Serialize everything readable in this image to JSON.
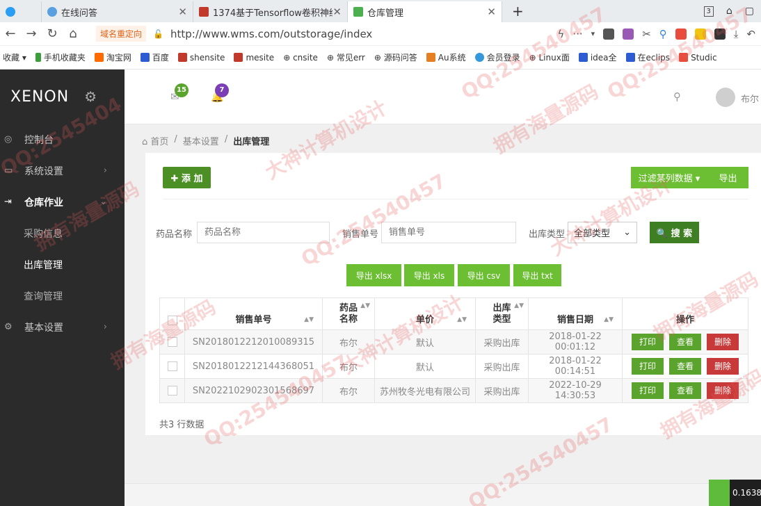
{
  "browser": {
    "tabs": [
      {
        "label": "在线问答",
        "color": "#3b82f6"
      },
      {
        "label": "1374基于Tensorflow卷积神经",
        "color": "#c0392b"
      },
      {
        "label": "仓库管理",
        "color": "#4caf50"
      }
    ],
    "redirect_label": "域名重定向",
    "url": "http://www.wms.com/outstorage/index",
    "tab_count_badge": "3",
    "bookmarks": [
      "收藏",
      "手机收藏夹",
      "淘宝网",
      "百度",
      "shensite",
      "mesite",
      "cnsite",
      "常见err",
      "源码问答",
      "Au系统",
      "会员登录",
      "Linux面",
      "idea全",
      "在eclips",
      "Studic"
    ]
  },
  "sidebar": {
    "brand": "XENON",
    "items": [
      {
        "label": "控制台",
        "icon": "dashboard-icon",
        "glyph": "◎"
      },
      {
        "label": "系统设置",
        "icon": "monitor-icon",
        "glyph": "▭",
        "chevron": "›"
      },
      {
        "label": "仓库作业",
        "icon": "signout-icon",
        "glyph": "⇥",
        "chevron": "⌄"
      }
    ],
    "sub_items": [
      "采购信息",
      "出库管理",
      "查询管理"
    ],
    "last_item": {
      "label": "基本设置",
      "icon": "gear-icon",
      "glyph": "⚙",
      "chevron": "›"
    }
  },
  "topbar": {
    "mail_badge": "15",
    "bell_badge": "7",
    "username": "布尔",
    "colors": {
      "mail_badge": "#5aa32c",
      "bell_badge": "#7b3fb5"
    }
  },
  "breadcrumb": {
    "home": "首页",
    "parent": "基本设置",
    "current": "出库管理",
    "sep": "/"
  },
  "toolbar": {
    "add": "✚ 添 加",
    "filter": "过滤某列数据 ▾",
    "export": "导出"
  },
  "filters": {
    "drug_label": "药品名称",
    "drug_placeholder": "药品名称",
    "sale_label": "销售单号",
    "sale_placeholder": "销售单号",
    "type_label": "出库类型",
    "type_value": "全部类型",
    "search": "🔍 搜 索"
  },
  "export_buttons": [
    "导出 xlsx",
    "导出 xls",
    "导出 csv",
    "导出 txt"
  ],
  "table": {
    "headers": [
      "销售单号",
      "药品\n名称",
      "单价",
      "出库\n类型",
      "销售日期",
      "操作"
    ],
    "rows": [
      {
        "id": "SN2018012212010089315",
        "drug": "布尔",
        "price": "默认",
        "type": "采购出库",
        "date": "2018-01-22 00:01:12"
      },
      {
        "id": "SN2018012212144368051",
        "drug": "布尔",
        "price": "默认",
        "type": "采购出库",
        "date": "2018-01-22 00:14:51"
      },
      {
        "id": "SN2022102902301568697",
        "drug": "布尔",
        "price": "苏州牧冬光电有限公司",
        "type": "采购出库",
        "date": "2022-10-29 14:30:53"
      }
    ],
    "actions": {
      "print": "打印",
      "view": "查看",
      "delete": "删除"
    },
    "total": "共3 行数据"
  },
  "corner": {
    "value": "0.1638"
  },
  "watermarks": [
    "QQ:2545404",
    "大神计算机设计",
    "拥有海量源码",
    "QQ:254540457",
    "QQ:254540457",
    "拥有海量源码",
    "大神计算机设计",
    "QQ:254540457",
    "拥有海量源码",
    "大神计算机设计",
    "拥有海量源码",
    "QQ:254540457",
    "QQ:254540457",
    "拥有海量源码"
  ]
}
